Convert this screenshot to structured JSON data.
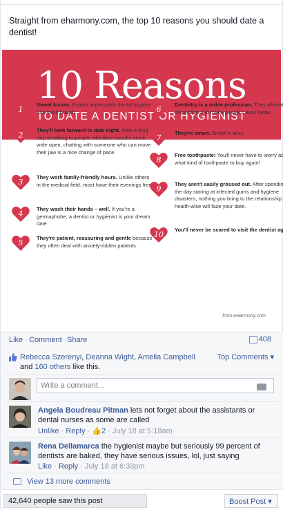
{
  "post": {
    "text": "Straight from eharmony.com, the top 10 reasons you should date a dentist!"
  },
  "infographic": {
    "title": "10 Reasons",
    "subtitle": "TO DATE A DENTIST OR HYGIENIST",
    "credit": "from eHarmony.com",
    "accent": "#d4374e",
    "reasons": [
      {
        "num": "1",
        "bold": "Sweet kisses.",
        "text": " Expect impeccable dental hygiene and fresh breath."
      },
      {
        "num": "2",
        "bold": "They'll look forward to date night.",
        "text": " After a long day of talking to people with their mouths stuck wide open, chatting with someone who can move their jaw is a nice change of pace."
      },
      {
        "num": "3",
        "bold": "They work family-friendly hours.",
        "text": " Unlike others in the medical field, most have their evenings free."
      },
      {
        "num": "4",
        "bold": "They wash their hands – well.",
        "text": " If you're a germaphobe, a dentist or hygienist is your dream date."
      },
      {
        "num": "5",
        "bold": "They're patient, reassuring and gentle",
        "text": " because they often deal with anxiety-ridden patients."
      },
      {
        "num": "6",
        "bold": "Dentistry is a noble profession.",
        "text": " They alleviate discomfort and make people's lives better."
      },
      {
        "num": "7",
        "bold": "They're smart.",
        "text": " Smart is sexy."
      },
      {
        "num": "8",
        "bold": "Free toothpaste!",
        "text": " You'll never have to worry about what kind of toothpaste to buy again!"
      },
      {
        "num": "9",
        "bold": "They aren't easily grossed out.",
        "text": " After spending the day staring at infected gums and hygiene disasters, nothing you bring to the relationship health-wise will faze your date."
      },
      {
        "num": "10",
        "bold": "You'll never be scared to visit the dentist again!",
        "text": ""
      }
    ]
  },
  "actions": {
    "like": "Like",
    "comment": "Comment",
    "share": "Share",
    "sep": "·",
    "share_count": "408"
  },
  "likes": {
    "names": [
      "Rebecca Szerenyi",
      "Deanna Wight",
      "Amelia Campbell"
    ],
    "sep1": ", ",
    "and": " and ",
    "others": "160 others",
    "tail": " like this.",
    "top_comments": "Top Comments ▾"
  },
  "write_comment": {
    "placeholder": "Write a comment..."
  },
  "comments": [
    {
      "name": "Angela Boudreau Pitman",
      "text": " lets not forget about the assistants or dental nurses as some are called",
      "unlike": "Unlike",
      "reply": "Reply",
      "likes": "2",
      "time": "July 18 at 5:18am"
    },
    {
      "name": "Rena Dellamarca",
      "text": " the hygienist maybe but seriously 99 percent of dentists are baked, they have serious issues, lol, just saying",
      "like": "Like",
      "reply": "Reply",
      "time": "July 18 at 6:33pm"
    }
  ],
  "more_comments": "View 13 more comments",
  "footer": {
    "reach": "42,640 people saw this post",
    "boost": "Boost Post ▾"
  }
}
